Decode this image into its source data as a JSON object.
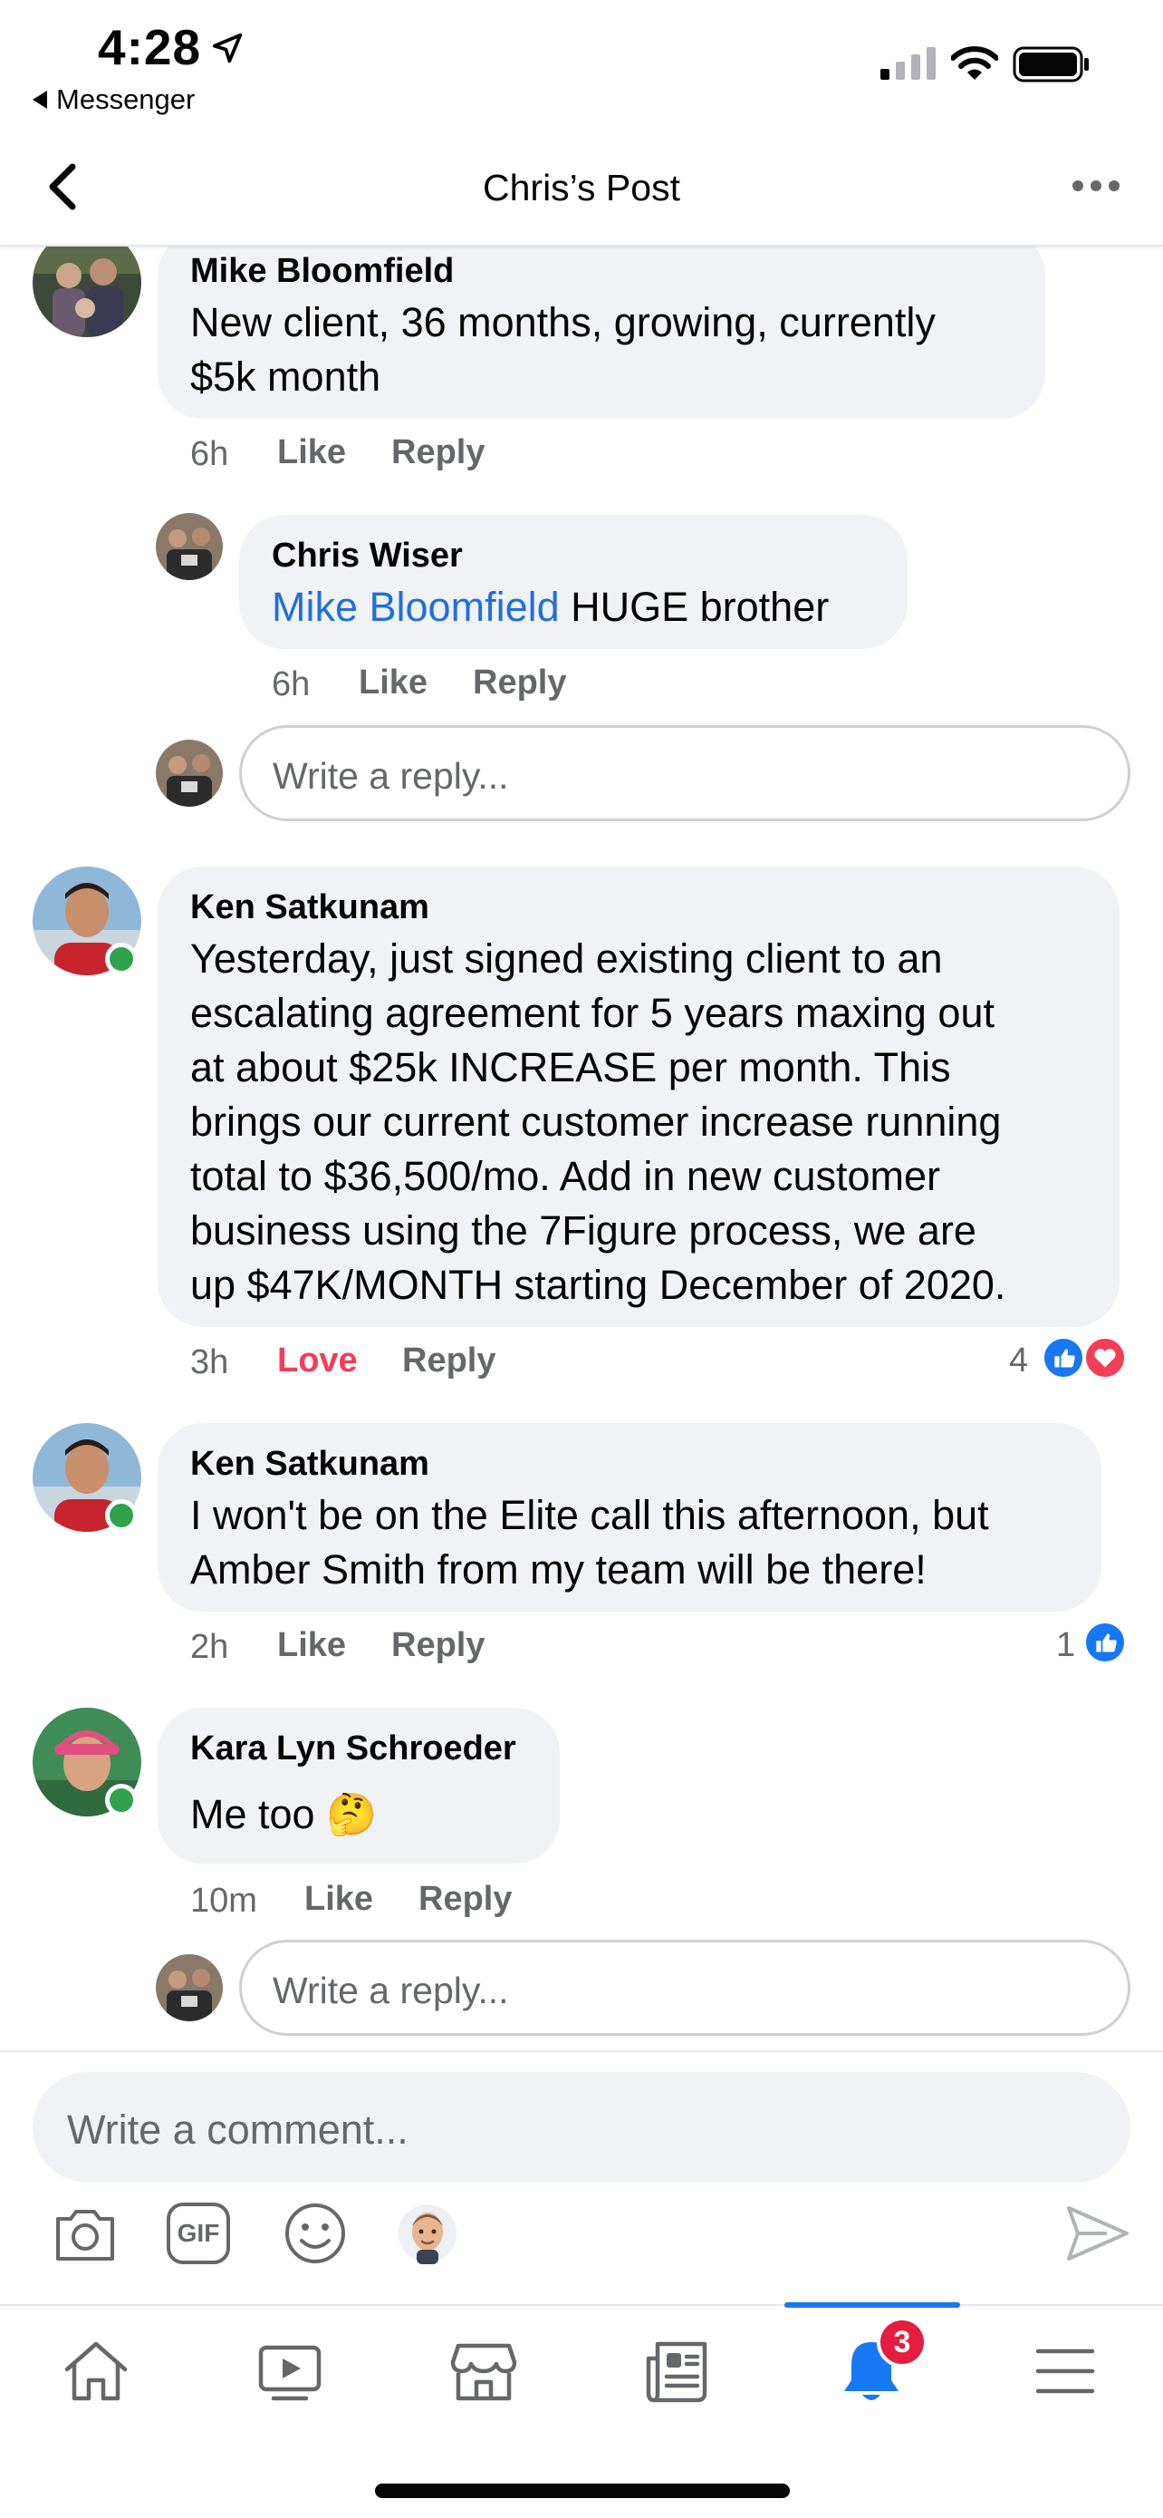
{
  "status_bar": {
    "time": "4:28",
    "back_app": "Messenger"
  },
  "header": {
    "title": "Chris’s Post"
  },
  "comments": [
    {
      "author": "Mike Bloomfield",
      "lines": [
        "New client, 36 months, growing, currently",
        "$5k month"
      ],
      "time": "6h",
      "like": "Like",
      "reply": "Reply",
      "replies": [
        {
          "author": "Chris Wiser",
          "mention": "Mike Bloomfield",
          "text": " HUGE brother",
          "time": "6h",
          "like": "Like",
          "reply": "Reply"
        }
      ],
      "reply_placeholder": "Write a reply..."
    },
    {
      "author": "Ken Satkunam",
      "lines": [
        "Yesterday, just signed existing client to an",
        "escalating agreement for 5 years maxing out",
        "at about $25k INCREASE per month.  This",
        "brings our current customer increase running",
        "total to $36,500/mo.  Add in new customer",
        "business using the 7Figure process, we are",
        "up $47K/MONTH starting December of 2020."
      ],
      "time": "3h",
      "like": "Love",
      "reply": "Reply",
      "reaction_count": "4",
      "reactions": [
        "like",
        "love"
      ]
    },
    {
      "author": "Ken Satkunam",
      "lines": [
        "I won't be on the Elite call this afternoon, but",
        "Amber Smith from my team will be there!"
      ],
      "time": "2h",
      "like": "Like",
      "reply": "Reply",
      "reaction_count": "1",
      "reactions": [
        "like"
      ]
    },
    {
      "author": "Kara Lyn Schroeder",
      "lines": [
        "Me too"
      ],
      "emoji": "🤔",
      "time": "10m",
      "like": "Like",
      "reply": "Reply",
      "reply_placeholder": "Write a reply..."
    }
  ],
  "composer": {
    "placeholder": "Write a comment...",
    "tools": [
      "camera-icon",
      "gif-icon",
      "emoji-icon",
      "avatar-sticker-icon"
    ],
    "gif_label": "GIF"
  },
  "tabbar": {
    "tabs": [
      "home-icon",
      "watch-icon",
      "marketplace-icon",
      "news-icon",
      "notifications-icon",
      "menu-icon"
    ],
    "active": "notifications-icon",
    "notification_badge": "3"
  },
  "colors": {
    "accent": "#1877f2",
    "mention": "#216fdb",
    "love": "#f33e58",
    "bubble": "#f0f2f5",
    "online": "#31a24c",
    "badge": "#e41e3f"
  }
}
